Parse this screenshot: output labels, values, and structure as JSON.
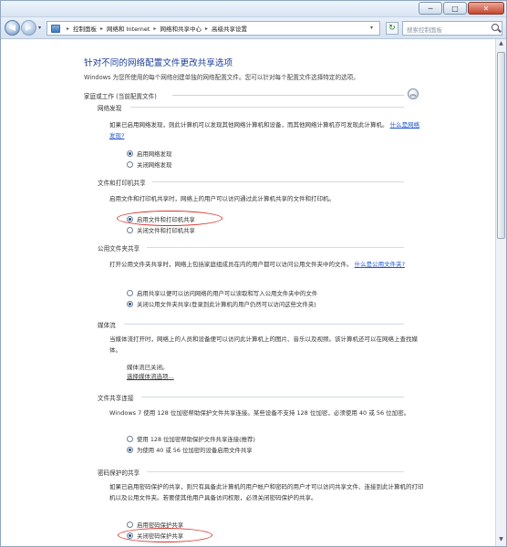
{
  "window": {
    "buttons": [
      "─",
      "□",
      "✕"
    ]
  },
  "nav": {
    "back": "◀",
    "forward": "▶",
    "recent": "▾"
  },
  "address": {
    "crumbs": [
      "控制面板",
      "网络和 Internet",
      "网络和共享中心",
      "高级共享设置"
    ],
    "separator": "▸",
    "dropdown": "▾",
    "refresh": "↻"
  },
  "search": {
    "placeholder": "搜索控制面板"
  },
  "page": {
    "title": "针对不同的网络配置文件更改共享选项",
    "intro": "Windows 为您所使用的每个网络创建单独的网络配置文件。您可以针对每个配置文件选择特定的选项。",
    "profile": "家庭或工作 (当前配置文件)",
    "collapse": "︽"
  },
  "sections": {
    "discovery": {
      "title": "网络发现",
      "desc": "如果已启用网络发现，则此计算机可以发现其他网络计算机和设备，而其他网络计算机亦可发现此计算机。",
      "link": "什么是网络发现?",
      "options": [
        "启用网络发现",
        "关闭网络发现"
      ],
      "selected": 0
    },
    "file_printer": {
      "title": "文件和打印机共享",
      "desc": "启用文件和打印机共享时，网络上的用户可以访问通过此计算机共享的文件和打印机。",
      "options": [
        "启用文件和打印机共享",
        "关闭文件和打印机共享"
      ],
      "selected": 0
    },
    "public_folder": {
      "title": "公用文件夹共享",
      "desc": "打开公用文件夹共享时，网络上包括家庭组成员在内的用户都可以访问公用文件夹中的文件。",
      "link": "什么是公用文件夹?",
      "options": [
        "启用共享以便可以访问网络的用户可以读取和写入公用文件夹中的文件",
        "关闭公用文件夹共享(登录到此计算机的用户仍然可以访问这些文件夹)"
      ],
      "selected": 1
    },
    "media": {
      "title": "媒体流",
      "desc": "当媒体流打开时，网络上的人员和设备便可以访问此计算机上的图片、音乐以及视频。该计算机还可以在网络上查找媒体。",
      "status": "媒体流已关闭。",
      "link": "选择媒体流选项..."
    },
    "connections": {
      "title": "文件共享连接",
      "desc": "Windows 7 使用 128 位加密帮助保护文件共享连接。某些设备不支持 128 位加密，必须使用 40 或 56 位加密。",
      "options": [
        "使用 128 位加密帮助保护文件共享连接(推荐)",
        "为使用 40 或 56 位加密的设备启用文件共享"
      ],
      "selected": 1
    },
    "password": {
      "title": "密码保护的共享",
      "desc": "如果已启用密码保护的共享，则只有具备此计算机的用户帐户和密码的用户才可以访问共享文件、连接到此计算机的打印机以及公用文件夹。若要使其他用户具备访问权限，必须关闭密码保护的共享。",
      "options": [
        "启用密码保护共享",
        "关闭密码保护共享"
      ],
      "selected": 1
    }
  },
  "colors": {
    "heading": "#1e3f9a",
    "link": "#2255cc",
    "annotation": "#d8342e"
  }
}
